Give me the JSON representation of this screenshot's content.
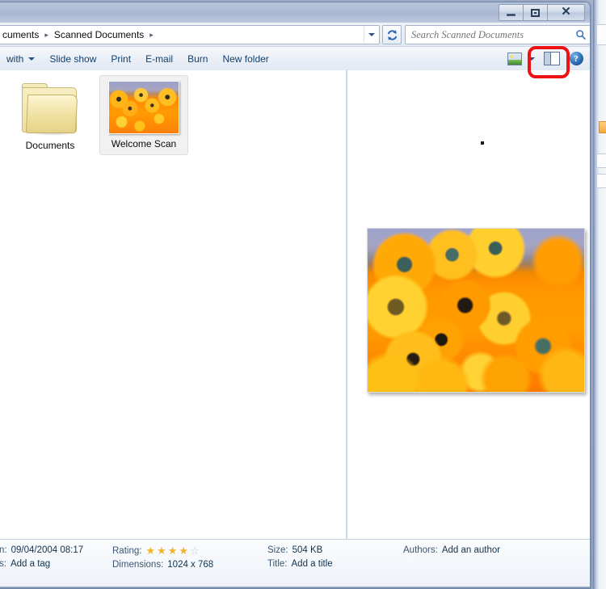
{
  "window": {
    "controls": {
      "minimize_label": "Minimize",
      "restore_label": "Restore",
      "close_label": "Close",
      "close_glyph": "✕"
    }
  },
  "address_bar": {
    "breadcrumb": [
      {
        "label": "cuments",
        "truncated": true
      },
      {
        "label": "Scanned Documents",
        "truncated": false
      }
    ],
    "separator": "▸",
    "dropdown_icon": "chevron-down-icon",
    "refresh_icon": "refresh-icon"
  },
  "search": {
    "placeholder": "Search Scanned Documents",
    "value": "",
    "icon": "search-icon"
  },
  "toolbar": {
    "items": [
      {
        "label": "with",
        "has_dropdown": true,
        "truncated": true
      },
      {
        "label": "Slide show",
        "has_dropdown": false
      },
      {
        "label": "Print",
        "has_dropdown": false
      },
      {
        "label": "E-mail",
        "has_dropdown": false
      },
      {
        "label": "Burn",
        "has_dropdown": false
      },
      {
        "label": "New folder",
        "has_dropdown": false
      }
    ],
    "view_icon": "change-view-icon",
    "view_dropdown_icon": "chevron-down-icon",
    "preview_pane_icon": "preview-pane-icon",
    "help_icon": "help-icon",
    "help_glyph": "?"
  },
  "annotation": {
    "highlight_target": "preview-pane-toggle",
    "color": "#ee1111",
    "shape": "rounded-rectangle"
  },
  "file_list": {
    "items": [
      {
        "name": "Documents",
        "type": "folder",
        "selected": false
      },
      {
        "name": "Welcome Scan",
        "type": "image",
        "selected": true
      }
    ]
  },
  "preview_pane": {
    "image_alt": "Welcome Scan preview - orange daisy flowers field"
  },
  "details_pane": {
    "columns": [
      {
        "rows": [
          {
            "label": "n:",
            "value": "09/04/2004 08:17",
            "full_label": "Date taken"
          },
          {
            "label": "s:",
            "value": "Add a tag",
            "full_label": "Tags"
          }
        ]
      },
      {
        "rows": [
          {
            "label": "Rating:",
            "value": "",
            "rating": 4,
            "rating_max": 5
          },
          {
            "label": "Dimensions:",
            "value": "1024 x 768"
          }
        ]
      },
      {
        "rows": [
          {
            "label": "Size:",
            "value": "504 KB"
          },
          {
            "label": "Title:",
            "value": "Add a title"
          }
        ]
      },
      {
        "rows": [
          {
            "label": "Authors:",
            "value": "Add an author"
          }
        ]
      }
    ],
    "star_on": "★",
    "star_off": "☆"
  },
  "colors": {
    "accent_link": "#13406b",
    "highlight_red": "#ee1111",
    "star_gold": "#f0b429",
    "folder_yellow": "#f0e0a0",
    "titlebar": "#aebbd5"
  }
}
